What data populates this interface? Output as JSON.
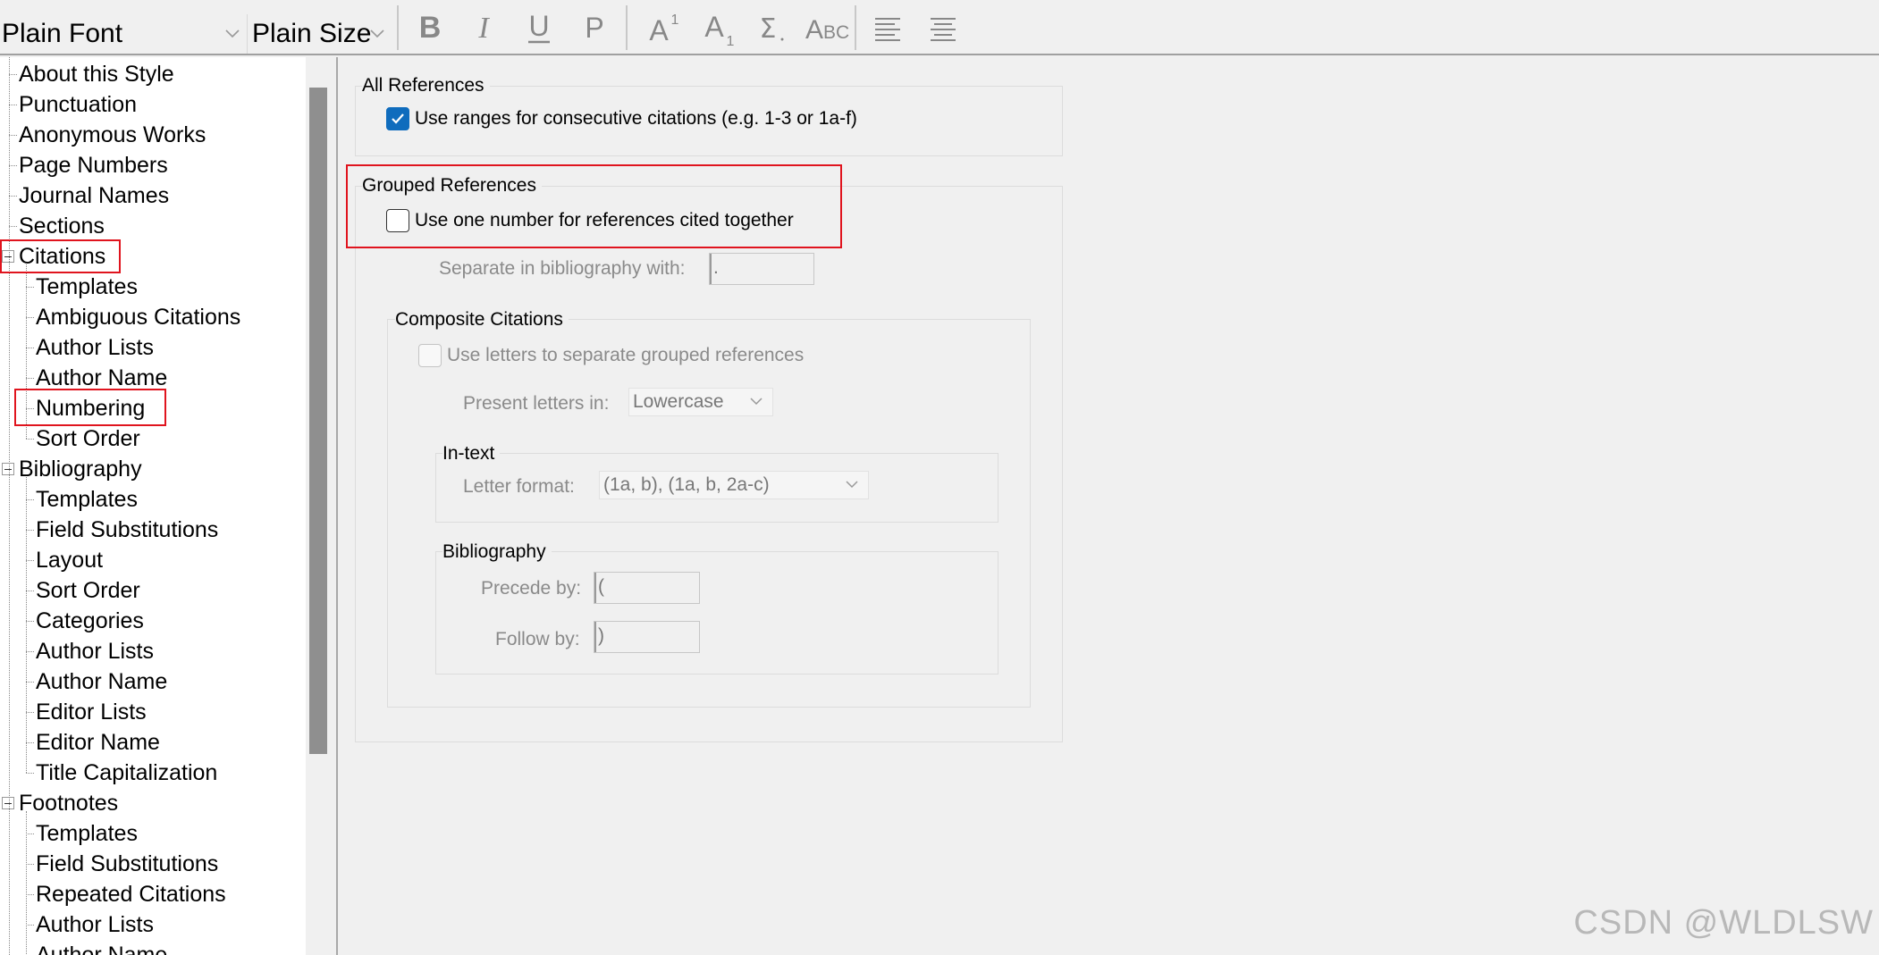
{
  "toolbar": {
    "font_value": "Plain Font",
    "size_value": "Plain Size",
    "buttons": [
      "bold-icon",
      "italic-icon",
      "underline-icon",
      "plain-icon",
      "superscript-icon",
      "subscript-icon",
      "symbol-icon",
      "small-caps-icon",
      "align-left-icon",
      "align-center-icon"
    ]
  },
  "tree": {
    "items": [
      {
        "label": "About this Style",
        "level": 0
      },
      {
        "label": "Punctuation",
        "level": 0
      },
      {
        "label": "Anonymous Works",
        "level": 0
      },
      {
        "label": "Page Numbers",
        "level": 0
      },
      {
        "label": "Journal Names",
        "level": 0
      },
      {
        "label": "Sections",
        "level": 0
      },
      {
        "label": "Citations",
        "level": 0,
        "expanded": true
      },
      {
        "label": "Templates",
        "level": 1
      },
      {
        "label": "Ambiguous Citations",
        "level": 1
      },
      {
        "label": "Author Lists",
        "level": 1
      },
      {
        "label": "Author Name",
        "level": 1
      },
      {
        "label": "Numbering",
        "level": 1,
        "selected": true
      },
      {
        "label": "Sort Order",
        "level": 1
      },
      {
        "label": "Bibliography",
        "level": 0,
        "expanded": true
      },
      {
        "label": "Templates",
        "level": 1
      },
      {
        "label": "Field Substitutions",
        "level": 1
      },
      {
        "label": "Layout",
        "level": 1
      },
      {
        "label": "Sort Order",
        "level": 1
      },
      {
        "label": "Categories",
        "level": 1
      },
      {
        "label": "Author Lists",
        "level": 1
      },
      {
        "label": "Author Name",
        "level": 1
      },
      {
        "label": "Editor Lists",
        "level": 1
      },
      {
        "label": "Editor Name",
        "level": 1
      },
      {
        "label": "Title Capitalization",
        "level": 1
      },
      {
        "label": "Footnotes",
        "level": 0,
        "expanded": true
      },
      {
        "label": "Templates",
        "level": 1
      },
      {
        "label": "Field Substitutions",
        "level": 1
      },
      {
        "label": "Repeated Citations",
        "level": 1
      },
      {
        "label": "Author Lists",
        "level": 1
      },
      {
        "label": "Author Name",
        "level": 1
      }
    ]
  },
  "all_refs": {
    "title": "All References",
    "ranges_label": "Use ranges for consecutive citations (e.g. 1-3 or 1a-f)",
    "ranges_checked": true
  },
  "grouped": {
    "title": "Grouped References",
    "one_number_label": "Use one number for references cited together",
    "one_number_checked": false,
    "separate_label": "Separate in bibliography with:",
    "separate_value": "."
  },
  "composite": {
    "title": "Composite Citations",
    "letters_label": "Use letters to separate grouped references",
    "present_label": "Present letters in:",
    "present_value": "Lowercase"
  },
  "intext": {
    "title": "In-text",
    "format_label": "Letter format:",
    "format_value": "(1a, b), (1a, b, 2a-c)"
  },
  "bibliography": {
    "title": "Bibliography",
    "precede_label": "Precede by:",
    "precede_value": "(",
    "follow_label": "Follow by:",
    "follow_value": ")"
  },
  "watermark": "CSDN @WLDLSW",
  "colors": {
    "checkbox_accent": "#0f6cbd",
    "highlight": "#e0141e"
  }
}
